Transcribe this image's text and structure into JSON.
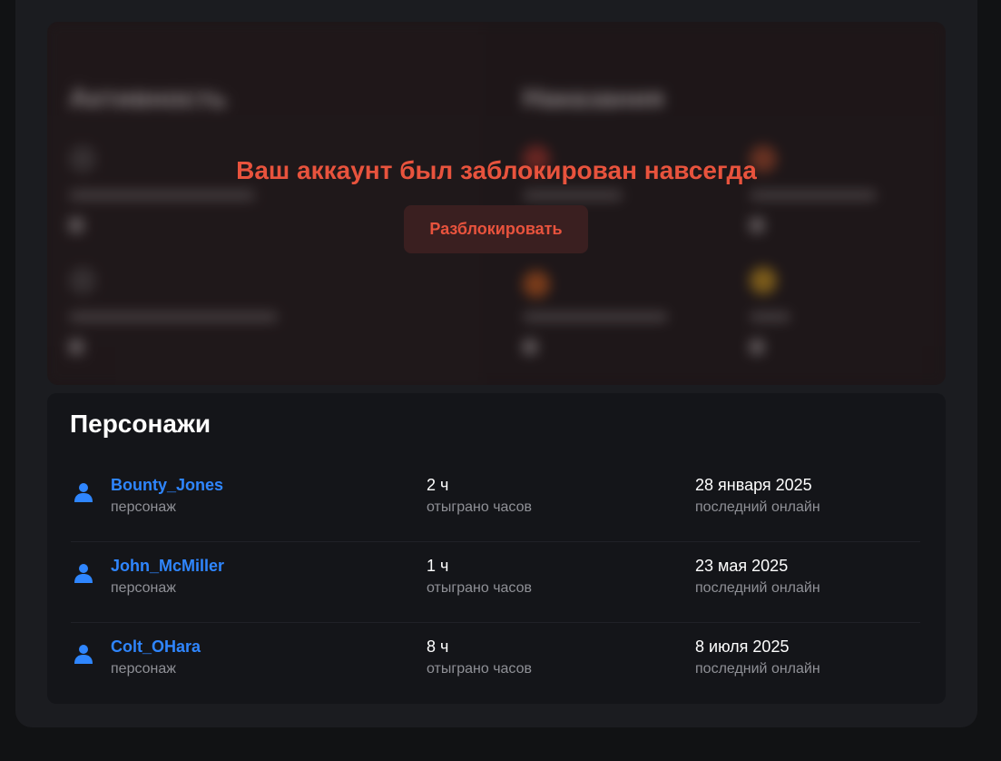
{
  "blocked": {
    "background_headings": [
      "Активность",
      "Наказания"
    ],
    "title": "Ваш аккаунт был заблокирован навсегда",
    "unblock_button": "Разблокировать",
    "accent_color": "#e8533d"
  },
  "characters": {
    "title": "Персонажи",
    "rows": [
      {
        "name": "Bounty_Jones",
        "subtitle": "персонаж",
        "hours": "2 ч",
        "hours_label": "отыграно часов",
        "last_online": "28 января 2025",
        "last_online_label": "последний онлайн"
      },
      {
        "name": "John_McMiller",
        "subtitle": "персонаж",
        "hours": "1 ч",
        "hours_label": "отыграно часов",
        "last_online": "23 мая 2025",
        "last_online_label": "последний онлайн"
      },
      {
        "name": "Colt_OHara",
        "subtitle": "персонаж",
        "hours": "8 ч",
        "hours_label": "отыграно часов",
        "last_online": "8 июля 2025",
        "last_online_label": "последний онлайн"
      }
    ],
    "name_color": "#2f86ff",
    "icon": "user-icon"
  }
}
